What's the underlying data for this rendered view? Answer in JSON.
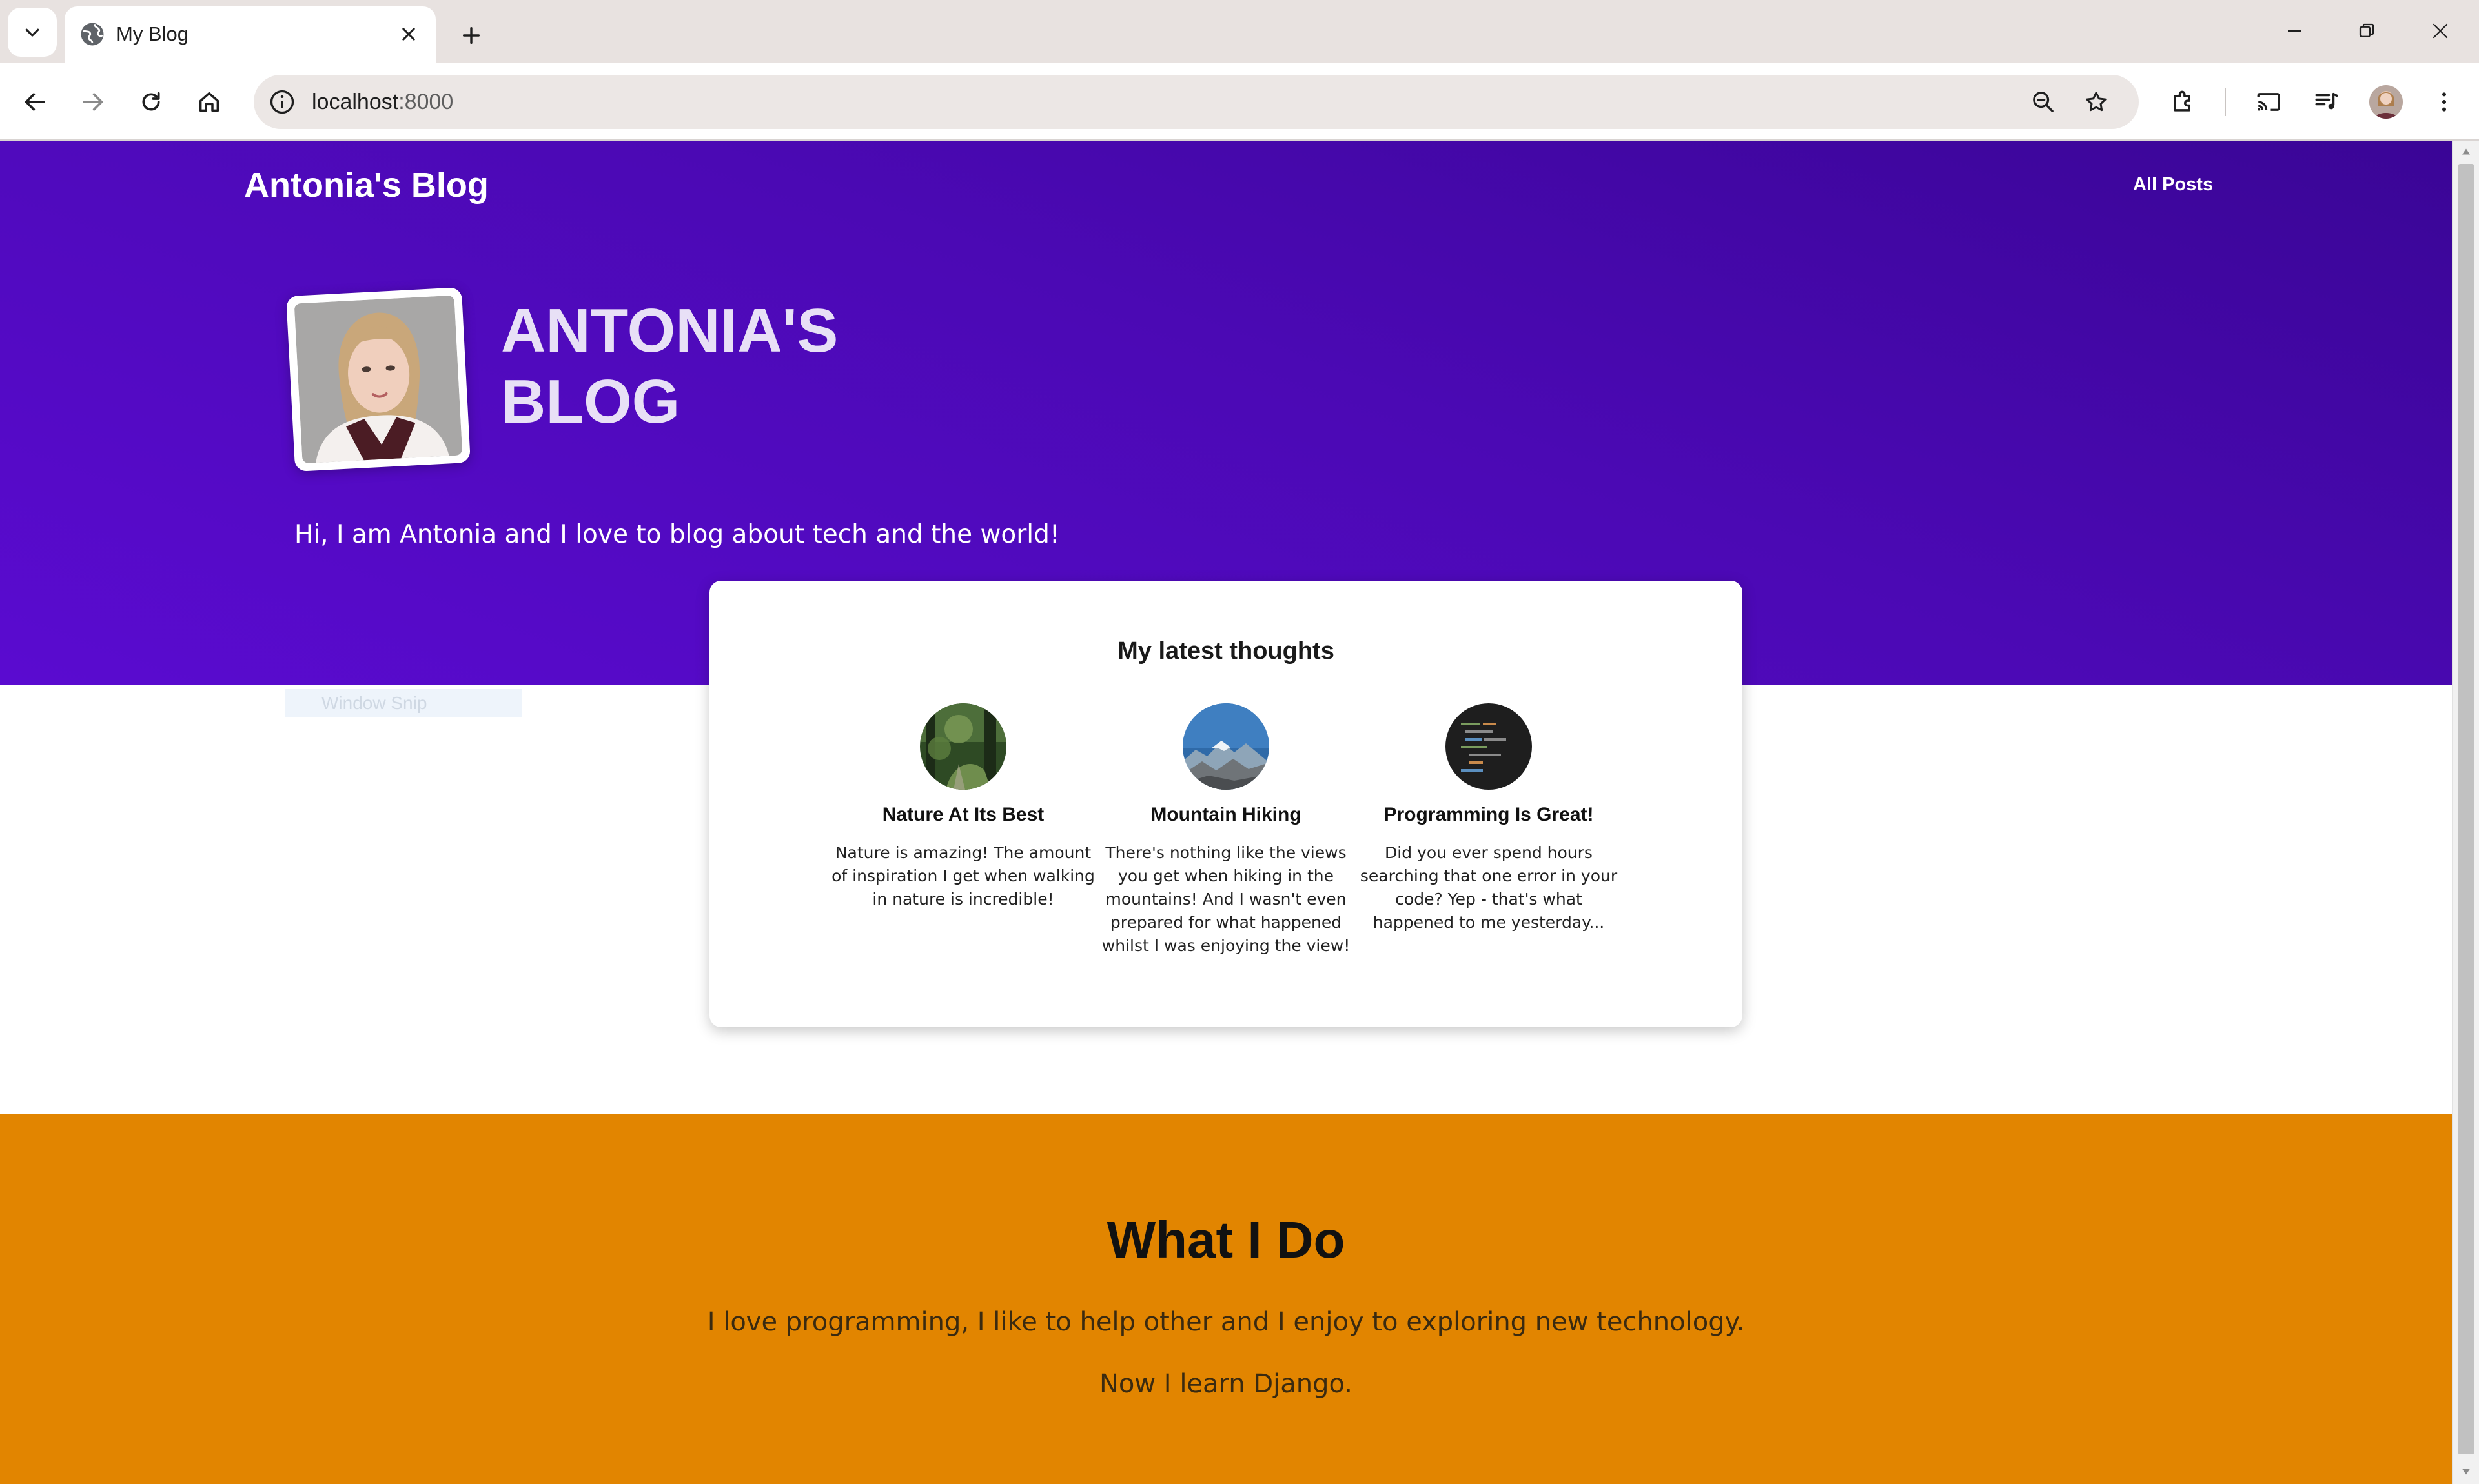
{
  "browser": {
    "tab_title": "My Blog",
    "url_host": "localhost",
    "url_port": ":8000"
  },
  "site": {
    "brand": "Antonia's Blog",
    "nav": {
      "all_posts": "All Posts"
    }
  },
  "hero": {
    "title": "ANTONIA'S BLOG",
    "tagline": "Hi, I am Antonia and I love to blog about tech and the world!"
  },
  "overlay": {
    "snip_label": "Window Snip"
  },
  "latest": {
    "title": "My latest thoughts",
    "posts": [
      {
        "title": "Nature At Its Best",
        "excerpt": "Nature is amazing! The amount of inspiration I get when walking in nature is incredible!",
        "image": "forest-thumbnail"
      },
      {
        "title": "Mountain Hiking",
        "excerpt": "There's nothing like the views you get when hiking in the mountains! And I wasn't even prepared for what happened whilst I was enjoying the view!",
        "image": "mountain-thumbnail"
      },
      {
        "title": "Programming Is Great!",
        "excerpt": "Did you ever spend hours searching that one error in your code? Yep - that's what happened to me yesterday...",
        "image": "code-thumbnail"
      }
    ]
  },
  "what_i_do": {
    "title": "What I Do",
    "line1": "I love programming, I like to help other and I enjoy to exploring new technology.",
    "line2": "Now I learn Django."
  },
  "colors": {
    "hero_start": "#3a0596",
    "hero_end": "#5a0bd0",
    "accent_orange": "#e28500",
    "card_bg": "#ffffff"
  }
}
